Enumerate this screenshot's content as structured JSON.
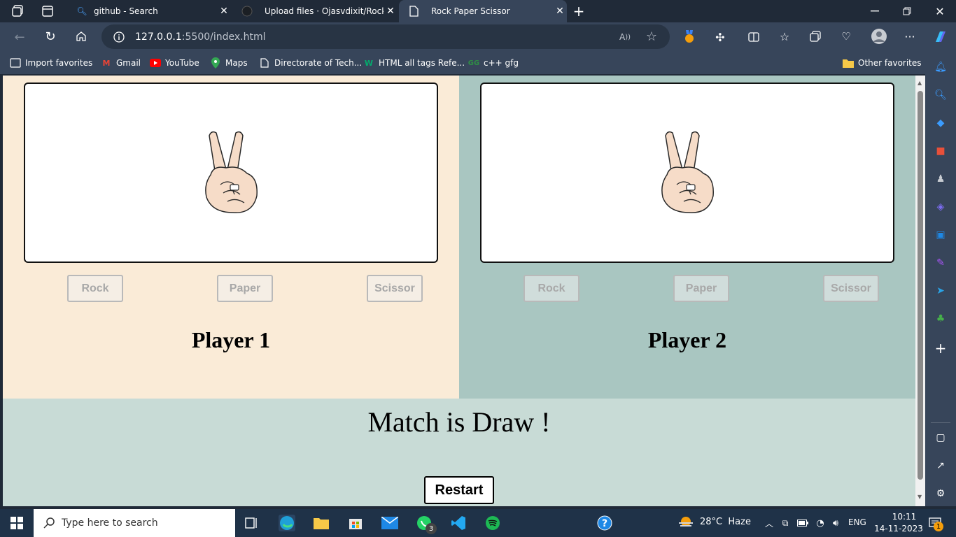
{
  "browser": {
    "tabs": [
      {
        "title": "github - Search"
      },
      {
        "title": "Upload files · Ojasvdixit/Rock_Pap"
      },
      {
        "title": "Rock Paper Scissor"
      }
    ],
    "address": {
      "host": "127.0.0.1",
      "path": ":5500/index.html"
    },
    "favorites": [
      {
        "label": "Import favorites"
      },
      {
        "label": "Gmail"
      },
      {
        "label": "YouTube"
      },
      {
        "label": "Maps"
      },
      {
        "label": "Directorate of Tech..."
      },
      {
        "label": "HTML  all tags Refe..."
      },
      {
        "label": "c++ gfg"
      },
      {
        "label": "Other favorites"
      }
    ]
  },
  "game": {
    "player1": {
      "name": "Player 1",
      "buttons": [
        "Rock",
        "Paper",
        "Scissor"
      ],
      "choice_icon": "scissor-hand-icon"
    },
    "player2": {
      "name": "Player 2",
      "buttons": [
        "Rock",
        "Paper",
        "Scissor"
      ],
      "choice_icon": "scissor-hand-icon"
    },
    "result": "Match is Draw !",
    "restart_label": "Restart"
  },
  "taskbar": {
    "search_placeholder": "Type here to search",
    "whatsapp_badge": "3",
    "weather": "28°C  Haze",
    "language": "ENG",
    "time": "10:11",
    "date": "14-11-2023",
    "notification_count": "1"
  },
  "colors": {
    "player1_bg": "#faebd7",
    "player2_bg": "#a9c6c1",
    "result_bg": "#c8dbd6"
  }
}
